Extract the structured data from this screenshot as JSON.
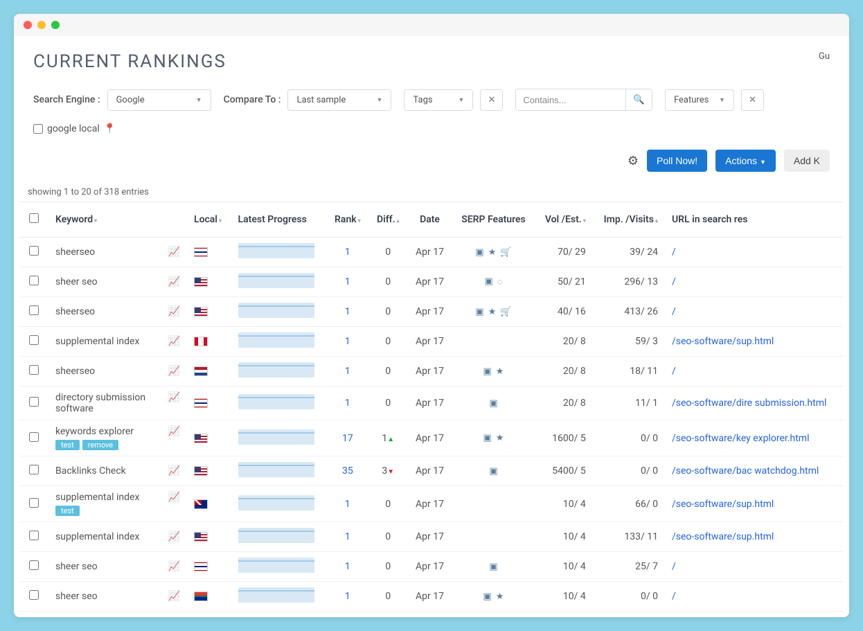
{
  "page_title": "CURRENT RANKINGS",
  "top_right_label": "Gu",
  "filters": {
    "search_engine_label": "Search Engine :",
    "search_engine_value": "Google",
    "compare_label": "Compare To :",
    "compare_value": "Last sample",
    "tags_label": "Tags",
    "contains_placeholder": "Contains...",
    "features_label": "Features",
    "google_local_label": "google local"
  },
  "buttons": {
    "poll_now": "Poll Now!",
    "actions": "Actions",
    "add_keywords": "Add K"
  },
  "entries_info": "showing 1 to 20 of 318 entries",
  "columns": {
    "keyword": "Keyword",
    "local": "Local",
    "latest_progress": "Latest Progress",
    "rank": "Rank",
    "diff": "Diff.",
    "date": "Date",
    "serp": "SERP Features",
    "vol_est": "Vol   /Est.",
    "imp_visits": "Imp.   /Visits",
    "url": "URL in search res"
  },
  "rows": [
    {
      "keyword": "sheerseo",
      "tags": [],
      "flag": "gb",
      "rank": "1",
      "diff": "0",
      "diff_dir": "",
      "date": "Apr 17",
      "serp": [
        "img",
        "star",
        "cart"
      ],
      "vol": "70/ 29",
      "imp": "39/  24",
      "url": "/"
    },
    {
      "keyword": "sheer seo",
      "tags": [],
      "flag": "us",
      "rank": "1",
      "diff": "0",
      "diff_dir": "",
      "date": "Apr 17",
      "serp": [
        "img",
        "spin"
      ],
      "vol": "50/ 21",
      "imp": "296/  13",
      "url": "/"
    },
    {
      "keyword": "sheerseo",
      "tags": [],
      "flag": "us",
      "rank": "1",
      "diff": "0",
      "diff_dir": "",
      "date": "Apr 17",
      "serp": [
        "img",
        "star",
        "cart"
      ],
      "vol": "40/ 16",
      "imp": "413/  26",
      "url": "/"
    },
    {
      "keyword": "supplemental index",
      "tags": [],
      "flag": "ca",
      "rank": "1",
      "diff": "0",
      "diff_dir": "",
      "date": "Apr 17",
      "serp": [],
      "vol": "20/ 8",
      "imp": "59/  3",
      "url": "/seo-software/sup.html"
    },
    {
      "keyword": "sheerseo",
      "tags": [],
      "flag": "nl",
      "rank": "1",
      "diff": "0",
      "diff_dir": "",
      "date": "Apr 17",
      "serp": [
        "img",
        "star"
      ],
      "vol": "20/ 8",
      "imp": "18/  11",
      "url": "/"
    },
    {
      "keyword": "directory submission software",
      "tags": [],
      "flag": "gb",
      "rank": "1",
      "diff": "0",
      "diff_dir": "",
      "date": "Apr 17",
      "serp": [
        "img"
      ],
      "vol": "20/ 8",
      "imp": "11/  1",
      "url": "/seo-software/dire submission.html"
    },
    {
      "keyword": "keywords explorer",
      "tags": [
        "test",
        "remove"
      ],
      "flag": "us",
      "rank": "17",
      "diff": "1",
      "diff_dir": "up",
      "date": "Apr 17",
      "serp": [
        "img",
        "star"
      ],
      "vol": "1600/ 5",
      "imp": "0/  0",
      "url": "/seo-software/key explorer.html"
    },
    {
      "keyword": "Backlinks Check",
      "tags": [],
      "flag": "us",
      "rank": "35",
      "diff": "3",
      "diff_dir": "down",
      "date": "Apr 17",
      "serp": [
        "img"
      ],
      "vol": "5400/ 5",
      "imp": "0/  0",
      "url": "/seo-software/bac watchdog.html"
    },
    {
      "keyword": "supplemental index",
      "tags": [
        "test"
      ],
      "flag": "au",
      "rank": "1",
      "diff": "0",
      "diff_dir": "",
      "date": "Apr 17",
      "serp": [],
      "vol": "10/ 4",
      "imp": "66/  0",
      "url": "/seo-software/sup.html"
    },
    {
      "keyword": "supplemental index",
      "tags": [],
      "flag": "us",
      "rank": "1",
      "diff": "0",
      "diff_dir": "",
      "date": "Apr 17",
      "serp": [],
      "vol": "10/ 4",
      "imp": "133/  11",
      "url": "/seo-software/sup.html"
    },
    {
      "keyword": "sheer seo",
      "tags": [],
      "flag": "gb",
      "rank": "1",
      "diff": "0",
      "diff_dir": "",
      "date": "Apr 17",
      "serp": [
        "img"
      ],
      "vol": "10/ 4",
      "imp": "25/  7",
      "url": "/"
    },
    {
      "keyword": "sheer seo",
      "tags": [],
      "flag": "za",
      "rank": "1",
      "diff": "0",
      "diff_dir": "",
      "date": "Apr 17",
      "serp": [
        "img",
        "star"
      ],
      "vol": "10/ 4",
      "imp": "0/  0",
      "url": "/"
    }
  ]
}
